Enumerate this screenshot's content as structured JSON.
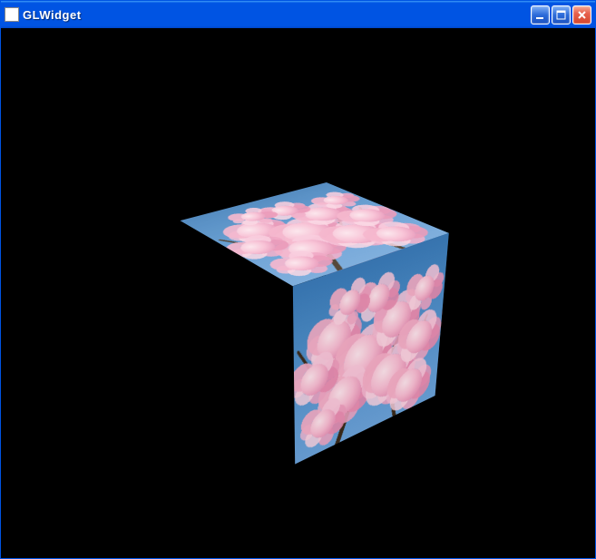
{
  "window": {
    "title": "GLWidget",
    "controls": {
      "minimize": "Minimize",
      "maximize": "Maximize",
      "close": "Close"
    }
  },
  "scene": {
    "background": "#000000",
    "object": "textured-cube",
    "texture_description": "cherry-blossoms-on-blue-sky"
  }
}
